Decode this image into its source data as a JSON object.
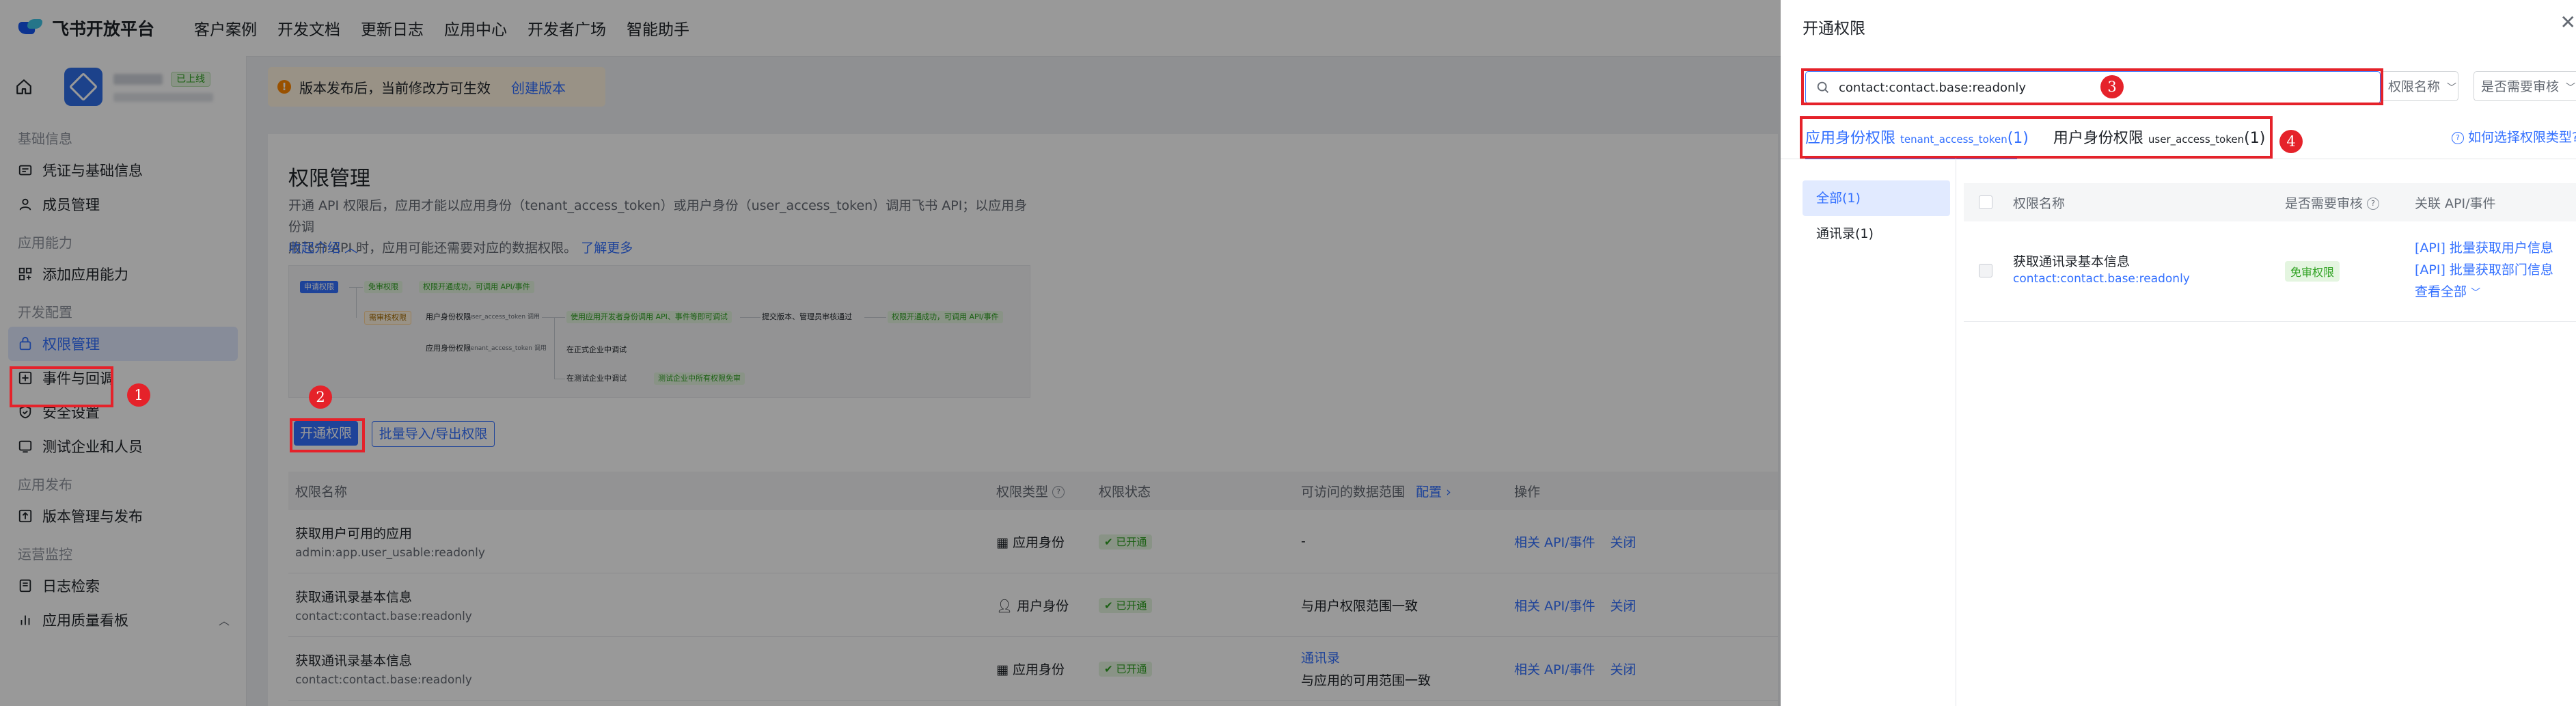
{
  "topbar": {
    "brand": "飞书开放平台",
    "nav": [
      "客户案例",
      "开发文档",
      "更新日志",
      "应用中心",
      "开发者广场",
      "智能助手"
    ]
  },
  "sidebar": {
    "app_status": "已上线",
    "sections": [
      {
        "title": "基础信息",
        "items": [
          "凭证与基础信息",
          "成员管理"
        ]
      },
      {
        "title": "应用能力",
        "items": [
          "添加应用能力"
        ]
      },
      {
        "title": "开发配置",
        "items": [
          "权限管理",
          "事件与回调",
          "安全设置",
          "测试企业和人员"
        ]
      },
      {
        "title": "应用发布",
        "items": [
          "版本管理与发布"
        ]
      },
      {
        "title": "运营监控",
        "items": [
          "日志检索",
          "应用质量看板"
        ]
      }
    ]
  },
  "banner": {
    "text": "版本发布后，当前修改方可生效",
    "link": "创建版本"
  },
  "permission_page": {
    "title": "权限管理",
    "desc_line1": "开通 API 权限后，应用才能以应用身份（tenant_access_token）或用户身份（user_access_token）调用飞书 API；以应用身份调",
    "desc_line2": "用飞书 API 时，应用可能还需要对应的数据权限。",
    "learn_more": "了解更多",
    "collapse": "收起介绍",
    "open_button": "开通权限",
    "import_export_button": "批量导入/导出权限",
    "diagram": {
      "tag_apply": "申请权限",
      "tag_free": "免审权限",
      "tag_review": "需审核权限",
      "free_result": "权限开通成功，可调用 API/事件",
      "user_identity": "用户身份权限",
      "user_token": "user_access_token 调用",
      "app_identity": "应用身份权限",
      "app_token": "tenant_access_token 调用",
      "step_debug": "使用应用开发者身份调用 API、事件等即可调试",
      "step_submit": "提交版本、管理员审核通过",
      "step_done": "权限开通成功，可调用 API/事件",
      "step_create_test": "在正式企业中调试",
      "step_test_ent": "在测试企业中调试",
      "step_test_done": "测试企业中所有权限免审"
    },
    "table": {
      "headers": [
        "权限名称",
        "权限类型",
        "权限状态",
        "可访问的数据范围",
        "配置",
        "操作"
      ],
      "rows": [
        {
          "name": "获取用户可用的应用",
          "key": "admin:app.user_usable:readonly",
          "type": "应用身份",
          "status": "已开通",
          "scope": "-",
          "scope2": "",
          "ops": [
            "相关 API/事件",
            "关闭"
          ]
        },
        {
          "name": "获取通讯录基本信息",
          "key": "contact:contact.base:readonly",
          "type": "用户身份",
          "status": "已开通",
          "scope": "与用户权限范围一致",
          "scope2": "",
          "ops": [
            "相关 API/事件",
            "关闭"
          ]
        },
        {
          "name": "获取通讯录基本信息",
          "key": "contact:contact.base:readonly",
          "type": "应用身份",
          "status": "已开通",
          "scope": "通讯录",
          "scope2": "与应用的可用范围一致",
          "ops": [
            "相关 API/事件",
            "关闭"
          ]
        }
      ]
    }
  },
  "markers": [
    "1",
    "2",
    "3",
    "4"
  ],
  "drawer": {
    "title": "开通权限",
    "search_value": "contact:contact.base:readonly",
    "filter_name": "权限名称",
    "filter_review": "是否需要审核",
    "tabs": [
      {
        "label": "应用身份权限",
        "token": "tenant_access_token",
        "count": "(1)"
      },
      {
        "label": "用户身份权限",
        "token": "user_access_token",
        "count": "(1)"
      }
    ],
    "help_link": "如何选择权限类型?",
    "categories": [
      "全部(1)",
      "通讯录(1)"
    ],
    "table_headers": [
      "权限名称",
      "是否需要审核",
      "关联 API/事件"
    ],
    "row": {
      "name": "获取通讯录基本信息",
      "key": "contact:contact.base:readonly",
      "review": "免审权限",
      "apis": [
        "[API] 批量获取用户信息",
        "[API] 批量获取部门信息"
      ],
      "view_all": "查看全部"
    }
  }
}
